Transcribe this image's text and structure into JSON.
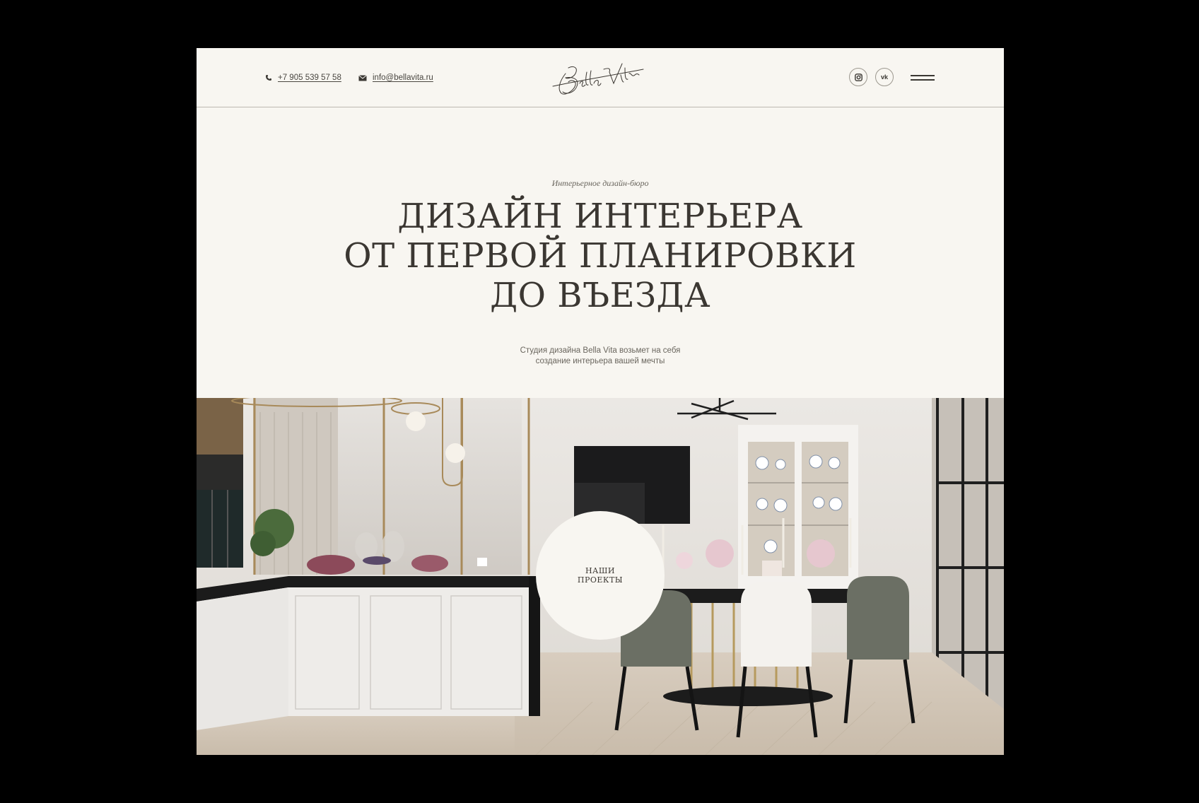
{
  "header": {
    "phone": "+7 905 539 57 58",
    "email": "info@bellavita.ru",
    "logo_text": "Bella Vita",
    "social": [
      {
        "name": "instagram-icon",
        "glyph": "◙"
      },
      {
        "name": "vk-icon",
        "glyph": "vk"
      }
    ],
    "menu_icon": "hamburger-menu-icon"
  },
  "hero": {
    "eyebrow": "Интерьерное дизайн-бюро",
    "headline": [
      "ДИЗАЙН ИНТЕРЬЕРА",
      "ОТ ПЕРВОЙ ПЛАНИРОВКИ",
      "ДО ВЪЕЗДА"
    ],
    "lead": [
      "Студия дизайна Bella Vita возьмет на себя",
      "создание интерьера вашей мечты"
    ]
  },
  "projects_button": {
    "line1": "НАШИ",
    "line2": "ПРОЕКТЫ"
  },
  "colors": {
    "background": "#f8f6f1",
    "text": "#3b3732",
    "outer": "#000000"
  }
}
